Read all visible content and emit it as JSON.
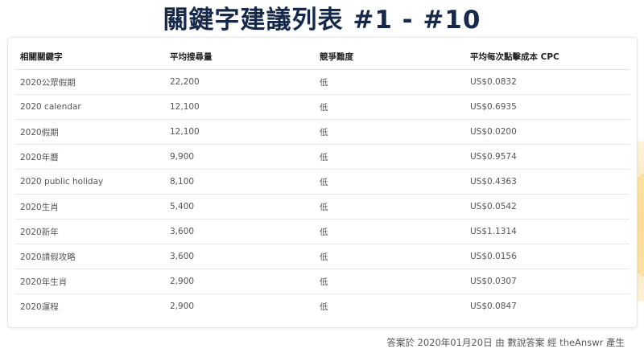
{
  "title": "關鍵字建議列表 #1 - #10",
  "table": {
    "headers": [
      "相關關鍵字",
      "平均搜尋量",
      "競爭難度",
      "平均每次點擊成本 CPC"
    ],
    "rows": [
      [
        "2020公眾假期",
        "22,200",
        "低",
        "US$0.0832"
      ],
      [
        "2020 calendar",
        "12,100",
        "低",
        "US$0.6935"
      ],
      [
        "2020假期",
        "12,100",
        "低",
        "US$0.0200"
      ],
      [
        "2020年曆",
        "9,900",
        "低",
        "US$0.9574"
      ],
      [
        "2020 public holiday",
        "8,100",
        "低",
        "US$0.4363"
      ],
      [
        "2020生肖",
        "5,400",
        "低",
        "US$0.0542"
      ],
      [
        "2020新年",
        "3,600",
        "低",
        "US$1.1314"
      ],
      [
        "2020請假攻略",
        "3,600",
        "低",
        "US$0.0156"
      ],
      [
        "2020年生肖",
        "2,900",
        "低",
        "US$0.0307"
      ],
      [
        "2020運程",
        "2,900",
        "低",
        "US$0.0847"
      ]
    ]
  },
  "footer": "答案於 2020年01月20日 由 數說答案 經 theAnswr 產生",
  "colors": {
    "title": "#16294a",
    "header_text": "#222222",
    "cell_text": "#555555",
    "border": "#e8e8e8",
    "deco_accent": "#f5c85a"
  }
}
